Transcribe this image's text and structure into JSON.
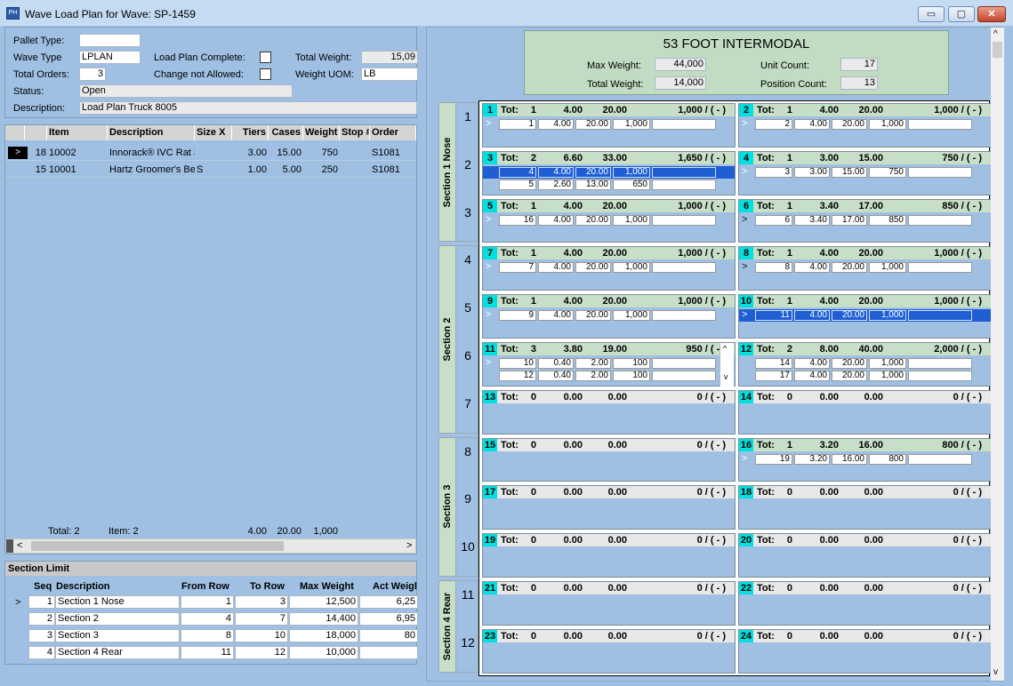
{
  "window": {
    "title": "Wave Load Plan for Wave: SP-1459",
    "icon_text": "PH",
    "minimize": "▭",
    "maximize": "▢",
    "close": "✕"
  },
  "header": {
    "pallet_type_label": "Pallet Type:",
    "pallet_type": "",
    "wave_type_label": "Wave Type",
    "wave_type": "LPLAN",
    "total_orders_label": "Total Orders:",
    "total_orders": "3",
    "status_label": "Status:",
    "status": "Open",
    "description_label": "Description:",
    "description": "Load Plan Truck 8005",
    "load_plan_complete_label": "Load Plan Complete:",
    "change_not_allowed_label": "Change not Allowed:",
    "total_weight_label": "Total Weight:",
    "total_weight": "15,09",
    "weight_uom_label": "Weight UOM:",
    "weight_uom": "LB"
  },
  "items": {
    "columns": [
      "Item",
      "Description",
      "Size X",
      "Tiers",
      "Cases",
      "Weight",
      "Stop #",
      "Order"
    ],
    "rows": [
      {
        "ptr": ">",
        "num": "18",
        "item": "10002",
        "description": "Innorack® IVC Rat 3",
        "size": "",
        "tiers": "3.00",
        "cases": "15.00",
        "weight": "750",
        "stop": "",
        "order": "S1081"
      },
      {
        "ptr": "",
        "num": "15",
        "item": "10001",
        "description": "Hartz Groomer's Be",
        "size": "S",
        "tiers": "1.00",
        "cases": "5.00",
        "weight": "250",
        "stop": "",
        "order": "S1081"
      }
    ],
    "footer": {
      "total": "Total: 2",
      "item": "Item: 2",
      "tiers": "4.00",
      "cases": "20.00",
      "weight": "1,000"
    }
  },
  "section_limit": {
    "title": "Section Limit",
    "columns": [
      "Seq",
      "Description",
      "From Row",
      "To Row",
      "Max Weight",
      "Act Weigl"
    ],
    "rows": [
      {
        "ptr": ">",
        "seq": "1",
        "description": "Section 1 Nose",
        "from": "1",
        "to": "3",
        "max": "12,500",
        "act": "6,25"
      },
      {
        "ptr": "",
        "seq": "2",
        "description": "Section 2",
        "from": "4",
        "to": "7",
        "max": "14,400",
        "act": "6,95"
      },
      {
        "ptr": "",
        "seq": "3",
        "description": "Section 3",
        "from": "8",
        "to": "10",
        "max": "18,000",
        "act": "80"
      },
      {
        "ptr": "",
        "seq": "4",
        "description": "Section 4 Rear",
        "from": "11",
        "to": "12",
        "max": "10,000",
        "act": ""
      }
    ]
  },
  "container": {
    "title": "53 FOOT INTERMODAL",
    "max_weight_label": "Max Weight:",
    "max_weight": "44,000",
    "total_weight_label": "Total Weight:",
    "total_weight": "14,000",
    "unit_count_label": "Unit Count:",
    "unit_count": "17",
    "position_count_label": "Position Count:",
    "position_count": "13"
  },
  "sections": [
    {
      "name": "Section 1 Nose"
    },
    {
      "name": "Section 2"
    },
    {
      "name": "Section 3"
    },
    {
      "name": "Section 4 Rear"
    }
  ],
  "row_numbers": [
    "1",
    "2",
    "3",
    "4",
    "5",
    "6",
    "7",
    "8",
    "9",
    "10",
    "11",
    "12"
  ],
  "tot_label": "Tot:",
  "positions": [
    {
      "n": "1",
      "tot": "1",
      "tiers": "4.00",
      "cases": "20.00",
      "wt": "1,000 / ( - )",
      "rows": [
        {
          "ptr": ">",
          "dk": false,
          "sel": false,
          "v": [
            "1",
            "4.00",
            "20.00",
            "1,000",
            ""
          ]
        }
      ]
    },
    {
      "n": "2",
      "tot": "1",
      "tiers": "4.00",
      "cases": "20.00",
      "wt": "1,000 / ( - )",
      "rows": [
        {
          "ptr": ">",
          "dk": false,
          "sel": false,
          "v": [
            "2",
            "4.00",
            "20.00",
            "1,000",
            ""
          ]
        }
      ]
    },
    {
      "n": "3",
      "tot": "2",
      "tiers": "6.60",
      "cases": "33.00",
      "wt": "1,650 / ( - )",
      "rows": [
        {
          "ptr": "",
          "dk": false,
          "sel": true,
          "v": [
            "4",
            "4.00",
            "20.00",
            "1,000",
            ""
          ]
        },
        {
          "ptr": "",
          "dk": false,
          "sel": false,
          "v": [
            "5",
            "2.60",
            "13.00",
            "650",
            ""
          ]
        }
      ]
    },
    {
      "n": "4",
      "tot": "1",
      "tiers": "3.00",
      "cases": "15.00",
      "wt": "750 / ( - )",
      "rows": [
        {
          "ptr": ">",
          "dk": false,
          "sel": false,
          "v": [
            "3",
            "3.00",
            "15.00",
            "750",
            ""
          ]
        }
      ]
    },
    {
      "n": "5",
      "tot": "1",
      "tiers": "4.00",
      "cases": "20.00",
      "wt": "1,000 / ( - )",
      "rows": [
        {
          "ptr": ">",
          "dk": false,
          "sel": false,
          "v": [
            "16",
            "4.00",
            "20.00",
            "1,000",
            ""
          ]
        }
      ]
    },
    {
      "n": "6",
      "tot": "1",
      "tiers": "3.40",
      "cases": "17.00",
      "wt": "850 / ( - )",
      "rows": [
        {
          "ptr": ">",
          "dk": true,
          "sel": false,
          "v": [
            "6",
            "3.40",
            "17.00",
            "850",
            ""
          ]
        }
      ]
    },
    {
      "n": "7",
      "tot": "1",
      "tiers": "4.00",
      "cases": "20.00",
      "wt": "1,000 / ( - )",
      "rows": [
        {
          "ptr": ">",
          "dk": false,
          "sel": false,
          "v": [
            "7",
            "4.00",
            "20.00",
            "1,000",
            ""
          ]
        }
      ]
    },
    {
      "n": "8",
      "tot": "1",
      "tiers": "4.00",
      "cases": "20.00",
      "wt": "1,000 / ( - )",
      "rows": [
        {
          "ptr": ">",
          "dk": true,
          "sel": false,
          "v": [
            "8",
            "4.00",
            "20.00",
            "1,000",
            ""
          ]
        }
      ]
    },
    {
      "n": "9",
      "tot": "1",
      "tiers": "4.00",
      "cases": "20.00",
      "wt": "1,000 / ( - )",
      "rows": [
        {
          "ptr": ">",
          "dk": false,
          "sel": false,
          "v": [
            "9",
            "4.00",
            "20.00",
            "1,000",
            ""
          ]
        }
      ]
    },
    {
      "n": "10",
      "tot": "1",
      "tiers": "4.00",
      "cases": "20.00",
      "wt": "1,000 / ( - )",
      "rows": [
        {
          "ptr": ">",
          "dk": false,
          "sel": true,
          "v": [
            "11",
            "4.00",
            "20.00",
            "1,000",
            ""
          ]
        }
      ]
    },
    {
      "n": "11",
      "tot": "3",
      "tiers": "3.80",
      "cases": "19.00",
      "wt": "950 / ( - )",
      "scroll": true,
      "rows": [
        {
          "ptr": ">",
          "dk": false,
          "sel": false,
          "v": [
            "10",
            "0.40",
            "2.00",
            "100",
            ""
          ]
        },
        {
          "ptr": "",
          "dk": false,
          "sel": false,
          "v": [
            "12",
            "0.40",
            "2.00",
            "100",
            ""
          ]
        }
      ]
    },
    {
      "n": "12",
      "tot": "2",
      "tiers": "8.00",
      "cases": "40.00",
      "wt": "2,000 / ( - )",
      "rows": [
        {
          "ptr": "",
          "dk": false,
          "sel": false,
          "v": [
            "14",
            "4.00",
            "20.00",
            "1,000",
            ""
          ]
        },
        {
          "ptr": "",
          "dk": false,
          "sel": false,
          "v": [
            "17",
            "4.00",
            "20.00",
            "1,000",
            ""
          ]
        }
      ]
    },
    {
      "n": "13",
      "tot": "0",
      "tiers": "0.00",
      "cases": "0.00",
      "wt": "0 / ( - )",
      "rows": []
    },
    {
      "n": "14",
      "tot": "0",
      "tiers": "0.00",
      "cases": "0.00",
      "wt": "0 / ( - )",
      "rows": []
    },
    {
      "n": "15",
      "tot": "0",
      "tiers": "0.00",
      "cases": "0.00",
      "wt": "0 / ( - )",
      "rows": []
    },
    {
      "n": "16",
      "tot": "1",
      "tiers": "3.20",
      "cases": "16.00",
      "wt": "800 / ( - )",
      "rows": [
        {
          "ptr": ">",
          "dk": false,
          "sel": false,
          "v": [
            "19",
            "3.20",
            "16.00",
            "800",
            ""
          ]
        }
      ]
    },
    {
      "n": "17",
      "tot": "0",
      "tiers": "0.00",
      "cases": "0.00",
      "wt": "0 / ( - )",
      "rows": []
    },
    {
      "n": "18",
      "tot": "0",
      "tiers": "0.00",
      "cases": "0.00",
      "wt": "0 / ( - )",
      "rows": []
    },
    {
      "n": "19",
      "tot": "0",
      "tiers": "0.00",
      "cases": "0.00",
      "wt": "0 / ( - )",
      "rows": []
    },
    {
      "n": "20",
      "tot": "0",
      "tiers": "0.00",
      "cases": "0.00",
      "wt": "0 / ( - )",
      "rows": []
    },
    {
      "n": "21",
      "tot": "0",
      "tiers": "0.00",
      "cases": "0.00",
      "wt": "0 / ( - )",
      "rows": []
    },
    {
      "n": "22",
      "tot": "0",
      "tiers": "0.00",
      "cases": "0.00",
      "wt": "0 / ( - )",
      "rows": []
    },
    {
      "n": "23",
      "tot": "0",
      "tiers": "0.00",
      "cases": "0.00",
      "wt": "0 / ( - )",
      "rows": []
    },
    {
      "n": "24",
      "tot": "0",
      "tiers": "0.00",
      "cases": "0.00",
      "wt": "0 / ( - )",
      "rows": []
    }
  ],
  "scroll": {
    "left": "<",
    "right": ">",
    "up": "^",
    "down": "v"
  }
}
